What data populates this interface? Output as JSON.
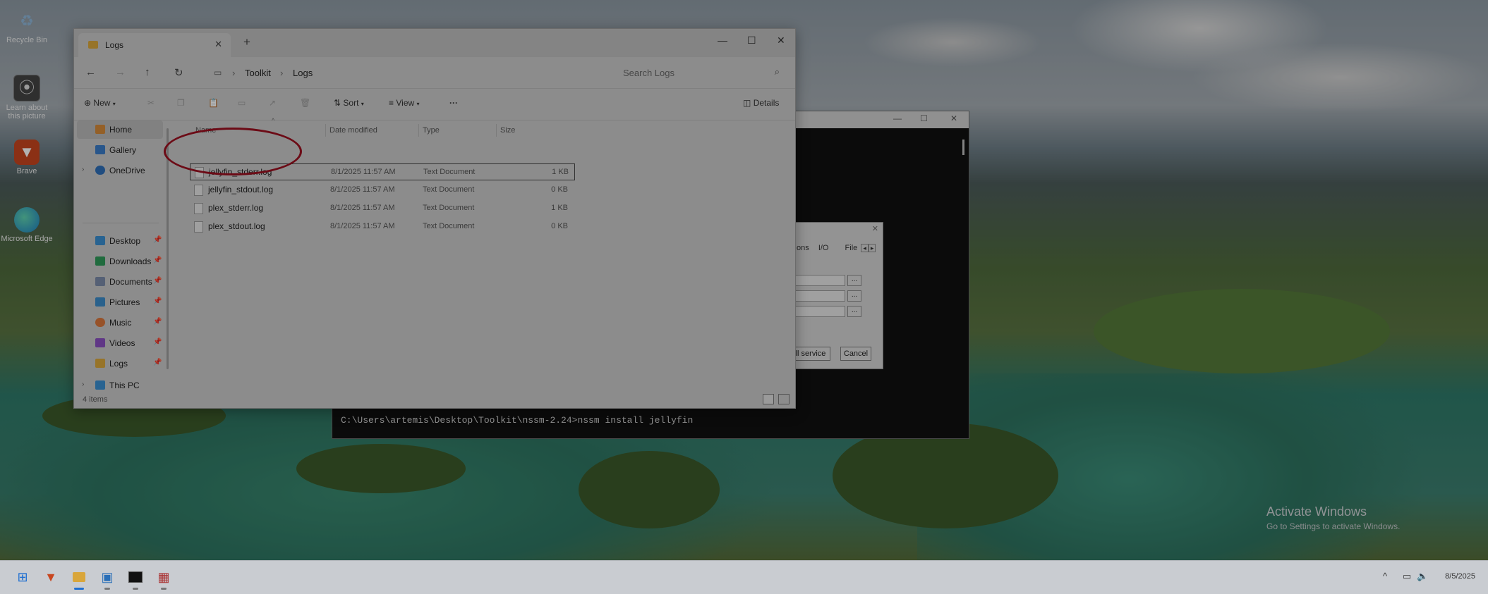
{
  "desktop": {
    "icons": [
      {
        "label": "Recycle Bin",
        "icon": "recycle-bin-icon"
      },
      {
        "label": "Learn about this picture",
        "icon": "info-icon"
      },
      {
        "label": "Brave",
        "icon": "brave-icon"
      },
      {
        "label": "Microsoft Edge",
        "icon": "edge-icon"
      }
    ],
    "watermark": {
      "line1": "Activate Windows",
      "line2": "Go to Settings to activate Windows."
    }
  },
  "console": {
    "command": "C:\\Users\\artemis\\Desktop\\Toolkit\\nssm-2.24>nssm install jellyfin"
  },
  "nssm_dialog": {
    "tabs": [
      "ons",
      "I/O",
      "File"
    ],
    "field_button": "...",
    "install_button": "ll service",
    "cancel_button": "Cancel"
  },
  "explorer": {
    "tab_title": "Logs",
    "breadcrumbs": [
      "Toolkit",
      "Logs"
    ],
    "search_placeholder": "Search Logs",
    "commands": {
      "new": "New",
      "sort": "Sort",
      "view": "View",
      "more": "···",
      "details": "Details"
    },
    "nav": [
      {
        "label": "Home",
        "icon": "home-icon",
        "color": "#d48a3a"
      },
      {
        "label": "Gallery",
        "icon": "gallery-icon",
        "color": "#3a7bc8"
      },
      {
        "label": "OneDrive",
        "icon": "cloud-icon",
        "color": "#2f6fb8"
      },
      {
        "label": "Desktop",
        "icon": "desktop-icon",
        "color": "#3a8fd0"
      },
      {
        "label": "Downloads",
        "icon": "download-icon",
        "color": "#2f9a5a"
      },
      {
        "label": "Documents",
        "icon": "documents-icon",
        "color": "#7a8aa8"
      },
      {
        "label": "Pictures",
        "icon": "pictures-icon",
        "color": "#3b8bc9"
      },
      {
        "label": "Music",
        "icon": "music-icon",
        "color": "#d9763b"
      },
      {
        "label": "Videos",
        "icon": "videos-icon",
        "color": "#8a4fc0"
      },
      {
        "label": "Logs",
        "icon": "folder-icon",
        "color": "#d9a63b"
      },
      {
        "label": "This PC",
        "icon": "computer-icon",
        "color": "#3a8fd0"
      }
    ],
    "columns": [
      "Name",
      "Date modified",
      "Type",
      "Size"
    ],
    "files": [
      {
        "name": "jellyfin_stderr.log",
        "date": "8/1/2025 11:57 AM",
        "type": "Text Document",
        "size": "1 KB"
      },
      {
        "name": "jellyfin_stdout.log",
        "date": "8/1/2025 11:57 AM",
        "type": "Text Document",
        "size": "0 KB"
      },
      {
        "name": "plex_stderr.log",
        "date": "8/1/2025 11:57 AM",
        "type": "Text Document",
        "size": "1 KB"
      },
      {
        "name": "plex_stdout.log",
        "date": "8/1/2025 11:57 AM",
        "type": "Text Document",
        "size": "0 KB"
      }
    ],
    "status": "4 items"
  },
  "taskbar": {
    "apps": [
      "windows-start-icon",
      "brave-icon",
      "file-explorer-icon",
      "monitor-icon",
      "terminal-icon",
      "app-icon"
    ],
    "clock": "8/5/2025"
  },
  "colors": {
    "annotation": "#9b1020",
    "folder": "#d9a63b"
  }
}
